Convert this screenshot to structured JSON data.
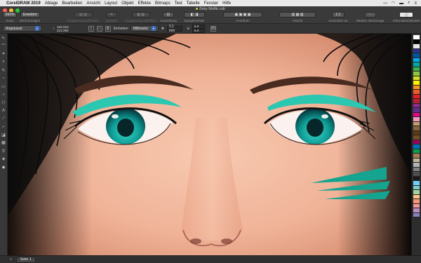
{
  "menubar": {
    "app_name": "CorelDRAW 2019",
    "items": [
      "Ablage",
      "Bearbeiten",
      "Ansicht",
      "Layout",
      "Objekt",
      "Effekte",
      "Bitmaps",
      "Text",
      "Tabelle",
      "Fenster",
      "Hilfe"
    ],
    "status_icons": [
      "cast-icon",
      "wifi-icon",
      "battery-icon",
      "search-icon",
      "menu-icon"
    ]
  },
  "window": {
    "title": "Zeky Muftic.cdr"
  },
  "toolbar": {
    "zoom": {
      "value": "691%",
      "caption": "Zoom"
    },
    "mode": {
      "value": "Erweitert",
      "caption": "Modi anzeigen"
    },
    "group1_caption": "Gruppierung aufheben",
    "group2_caption": "Spiegeln",
    "group3_caption": "Gruppierung aufheben",
    "align": {
      "caption": "Ausrichtung"
    },
    "mirror": {
      "caption": "Spiegelverhalt."
    },
    "arrange_caption": "Anordnen",
    "view_caption": "Ansicht",
    "align_to_caption": "Ausrichten an",
    "align_value": "1:1",
    "more_tools_caption": "Weitere Werkzeuge",
    "info_caption": "Informationsfenster"
  },
  "propbar": {
    "preset": "Angepasst",
    "x": "192.616",
    "y": "213.292",
    "units_label": "Einheiten:",
    "units_value": "Millimeter",
    "nudge": "0.1 mm",
    "dup_x": "5.0",
    "dup_y": "5.0"
  },
  "tools": [
    "pointer-icon",
    "freeform-icon",
    "crop-icon",
    "zoom-icon",
    "freehand-icon",
    "artistic-media-icon",
    "rectangle-icon",
    "ellipse-icon",
    "polygon-icon",
    "text-icon",
    "parallel-dimension-icon",
    "connector-icon",
    "drop-shadow-icon",
    "transparency-icon",
    "eyedropper-icon",
    "interactive-fill-icon",
    "smart-fill-icon"
  ],
  "palette": [
    "#ffffff",
    "#000000",
    "#e8e8e8",
    "#2e3192",
    "#0054a6",
    "#00aeef",
    "#00a99d",
    "#39b54a",
    "#8dc63f",
    "#d7df23",
    "#fff200",
    "#f7941d",
    "#f15a24",
    "#ed1c24",
    "#be1e2d",
    "#92278f",
    "#662d91",
    "#ec008c",
    "#f49ac1",
    "#c69c6d",
    "#8c6239",
    "#603913",
    "#754c24",
    "#9e005d",
    "#0072bc",
    "#00a651",
    "#a67c52",
    "#c2b59b",
    "#b3b3b3",
    "#808080",
    "#4d4d4d",
    "#1a1a1a",
    "#6dcff6",
    "#7accc8",
    "#a3d39c",
    "#fdc689",
    "#f69679",
    "#f5989d",
    "#bd8cbf",
    "#8781bd"
  ],
  "statusbar": {
    "page_tab": "Seite 1"
  },
  "colors": {
    "accent": "#3d6fc6",
    "eye_green": "#2cc7b0",
    "skin": "#f2b89e"
  }
}
